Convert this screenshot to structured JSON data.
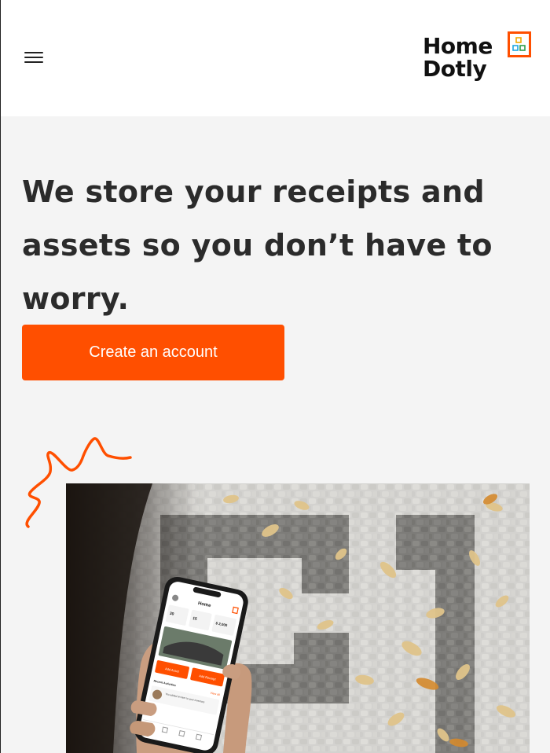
{
  "header": {
    "menu_icon": "hamburger-menu-icon",
    "logo": {
      "line1": "Home",
      "line2": "Dotly",
      "mark_icon": "house-window-icon",
      "brand_color": "#ff4f00"
    }
  },
  "hero": {
    "title_line1": "We store your receipts and",
    "title_line2": "assets so you don’t have to",
    "title_line3": "worry.",
    "cta_label": "Create an account",
    "accent_color": "#ff4f00"
  },
  "phone_screen": {
    "title": "Home",
    "stat1_value": "30",
    "stat2_value": "15",
    "stat3_value": "$ 2,000",
    "primary_action": "Add Asset",
    "secondary_action": "Add Receipt",
    "section_title": "Recent Activities",
    "section_link": "View all",
    "activity_text": "You added an item to your inventory"
  }
}
